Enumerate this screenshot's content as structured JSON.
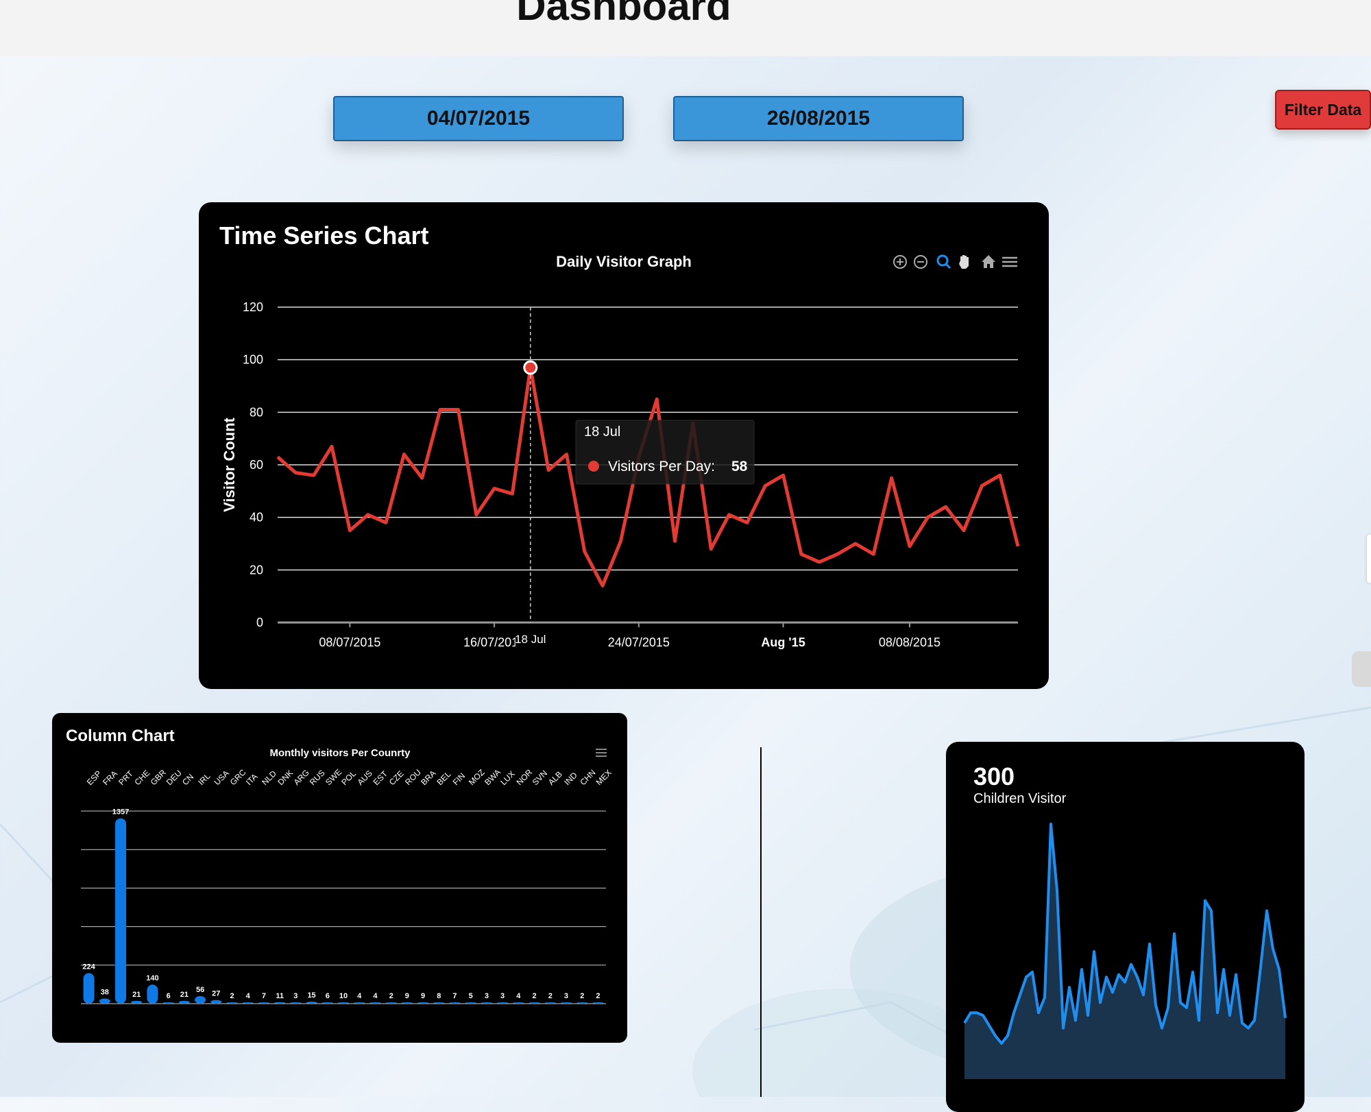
{
  "header": {
    "title": "Dashboard"
  },
  "filters": {
    "start_date": "04/07/2015",
    "end_date": "26/08/2015",
    "filter_label": "Filter Data"
  },
  "time_series": {
    "card_title": "Time Series Chart",
    "toolbar_icons": [
      "zoom-in-icon",
      "zoom-out-icon",
      "selection-zoom-icon",
      "pan-icon",
      "home-icon",
      "menu-icon"
    ],
    "tooltip": {
      "date": "18 Jul",
      "series_label": "Visitors Per Day:",
      "value": "58",
      "crosshair_label": "18 Jul"
    }
  },
  "column_chart": {
    "card_title": "Column Chart"
  },
  "kpi": {
    "value": "300",
    "label": "Children Visitor",
    "sparkline": [
      22,
      26,
      26,
      25,
      21,
      17,
      14,
      17,
      26,
      33,
      40,
      42,
      26,
      32,
      100,
      74,
      20,
      36,
      23,
      43,
      25,
      50,
      30,
      40,
      34,
      41,
      38,
      45,
      40,
      33,
      53,
      29,
      20,
      28,
      57,
      30,
      28,
      42,
      23,
      70,
      66,
      26,
      43,
      25,
      41,
      22,
      20,
      23,
      44,
      66,
      51,
      43,
      24
    ]
  },
  "colors": {
    "line": "#e33a33",
    "column": "#0f7ae5",
    "sparkline": "#1e8ff0",
    "filter": "#e03a3a",
    "date": "#3a96d9"
  },
  "chart_data": [
    {
      "type": "line",
      "title": "Daily Visitor Graph",
      "ylabel": "Visitor Count",
      "xlabel": "",
      "ylim": [
        0,
        120
      ],
      "yticks": [
        0,
        20,
        40,
        60,
        80,
        100,
        120
      ],
      "x_tick_labels": [
        "08/07/2015",
        "16/07/2015",
        "24/07/2015",
        "Aug '15",
        "08/08/2015"
      ],
      "grid": true,
      "series": [
        {
          "name": "Visitors Per Day",
          "x": [
            "2015-07-04",
            "2015-07-05",
            "2015-07-06",
            "2015-07-07",
            "2015-07-08",
            "2015-07-09",
            "2015-07-10",
            "2015-07-11",
            "2015-07-12",
            "2015-07-13",
            "2015-07-14",
            "2015-07-15",
            "2015-07-16",
            "2015-07-17",
            "2015-07-18",
            "2015-07-19",
            "2015-07-20",
            "2015-07-21",
            "2015-07-22",
            "2015-07-23",
            "2015-07-24",
            "2015-07-25",
            "2015-07-26",
            "2015-07-27",
            "2015-07-28",
            "2015-07-29",
            "2015-07-30",
            "2015-07-31",
            "2015-08-01",
            "2015-08-02",
            "2015-08-03",
            "2015-08-04",
            "2015-08-05",
            "2015-08-06",
            "2015-08-07",
            "2015-08-08",
            "2015-08-09",
            "2015-08-10",
            "2015-08-11",
            "2015-08-12",
            "2015-08-13",
            "2015-08-14"
          ],
          "values": [
            63,
            57,
            56,
            67,
            35,
            41,
            38,
            64,
            55,
            81,
            81,
            41,
            51,
            49,
            97,
            58,
            64,
            27,
            14,
            31,
            63,
            85,
            31,
            76,
            28,
            41,
            38,
            52,
            56,
            26,
            23,
            26,
            30,
            26,
            55,
            29,
            40,
            44,
            35,
            52,
            56,
            29
          ]
        }
      ]
    },
    {
      "type": "bar",
      "title": "Monthly visitors Per Counrty",
      "categories": [
        "ESP",
        "FRA",
        "PRT",
        "CHE",
        "GBR",
        "DEU",
        "CN",
        "IRL",
        "USA",
        "GRC",
        "ITA",
        "NLD",
        "DNK",
        "ARG",
        "RUS",
        "SWE",
        "POL",
        "AUS",
        "EST",
        "CZE",
        "ROU",
        "BRA",
        "BEL",
        "FIN",
        "MOZ",
        "BWA",
        "LUX",
        "NOR",
        "SVN",
        "ALB",
        "IND",
        "CHN",
        "MEX"
      ],
      "values": [
        224,
        38,
        1357,
        21,
        140,
        6,
        21,
        56,
        27,
        2,
        4,
        7,
        11,
        3,
        15,
        6,
        10,
        4,
        4,
        2,
        9,
        9,
        8,
        7,
        5,
        3,
        3,
        4,
        2,
        2,
        3,
        2,
        2
      ],
      "ylim": [
        0,
        1400
      ],
      "grid": true
    }
  ]
}
